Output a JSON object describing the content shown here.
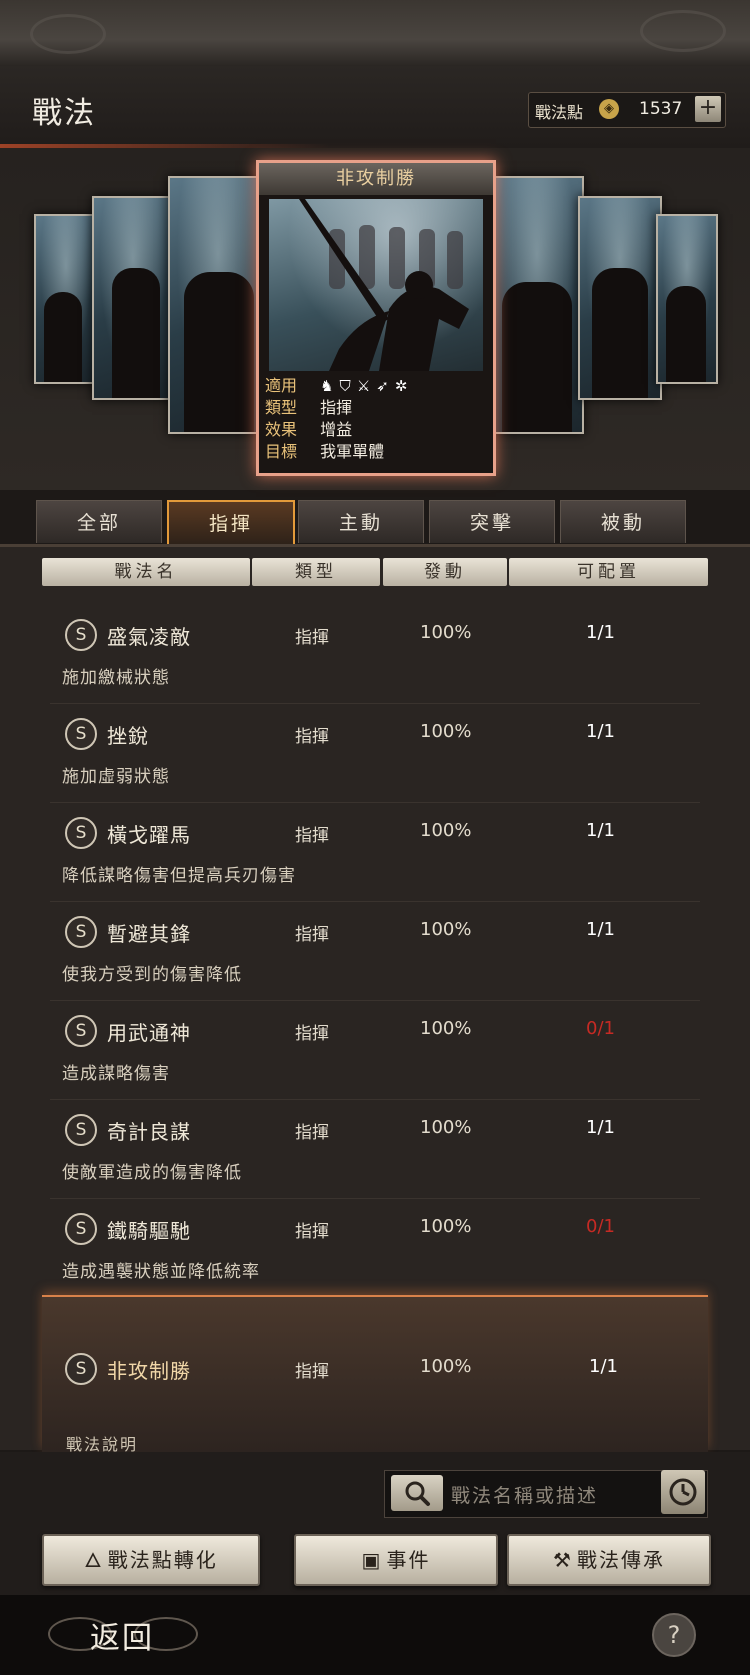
{
  "header": {
    "title": "戰法",
    "points_label": "戰法點",
    "points_value": "1537",
    "plus_label": "+"
  },
  "featured": {
    "title": "非攻制勝",
    "applicable_label": "適用",
    "applicable_icons": [
      "horse-icon",
      "shield-icon",
      "crossed-swords-icon",
      "bow-icon",
      "wheel-icon"
    ],
    "type_label": "類型",
    "type_value": "指揮",
    "effect_label": "效果",
    "effect_value": "增益",
    "target_label": "目標",
    "target_value": "我軍單體"
  },
  "tabs": [
    {
      "label": "全部",
      "active": false
    },
    {
      "label": "指揮",
      "active": true
    },
    {
      "label": "主動",
      "active": false
    },
    {
      "label": "突擊",
      "active": false
    },
    {
      "label": "被動",
      "active": false
    }
  ],
  "columns": {
    "name": "戰法名",
    "type": "類型",
    "trigger": "發動",
    "available": "可配置"
  },
  "rows": [
    {
      "grade": "S",
      "name": "盛氣凌敵",
      "type": "指揮",
      "trigger": "100%",
      "available": "1/1",
      "desc": "施加繳械狀態"
    },
    {
      "grade": "S",
      "name": "挫銳",
      "type": "指揮",
      "trigger": "100%",
      "available": "1/1",
      "desc": "施加虛弱狀態"
    },
    {
      "grade": "S",
      "name": "橫戈躍馬",
      "type": "指揮",
      "trigger": "100%",
      "available": "1/1",
      "desc": "降低謀略傷害但提高兵刃傷害"
    },
    {
      "grade": "S",
      "name": "暫避其鋒",
      "type": "指揮",
      "trigger": "100%",
      "available": "1/1",
      "desc": "使我方受到的傷害降低"
    },
    {
      "grade": "S",
      "name": "用武通神",
      "type": "指揮",
      "trigger": "100%",
      "available": "0/1",
      "desc": "造成謀略傷害"
    },
    {
      "grade": "S",
      "name": "奇計良謀",
      "type": "指揮",
      "trigger": "100%",
      "available": "1/1",
      "desc": "使敵軍造成的傷害降低"
    },
    {
      "grade": "S",
      "name": "鐵騎驅馳",
      "type": "指揮",
      "trigger": "100%",
      "available": "0/1",
      "desc": "造成遇襲狀態並降低統率"
    }
  ],
  "selected": {
    "grade": "S",
    "name": "非攻制勝",
    "type": "指揮",
    "trigger": "100%",
    "available": "1/1",
    "desc_label": "戰法說明"
  },
  "search": {
    "placeholder": "戰法名稱或描述"
  },
  "actions": {
    "convert": "戰法點轉化",
    "events": "事件",
    "inherit": "戰法傳承"
  },
  "footer": {
    "back": "返回",
    "help": "?"
  },
  "colors": {
    "accent": "#e39a3a",
    "unavailable": "#c62a24",
    "featured_border": "#e8a18a"
  }
}
